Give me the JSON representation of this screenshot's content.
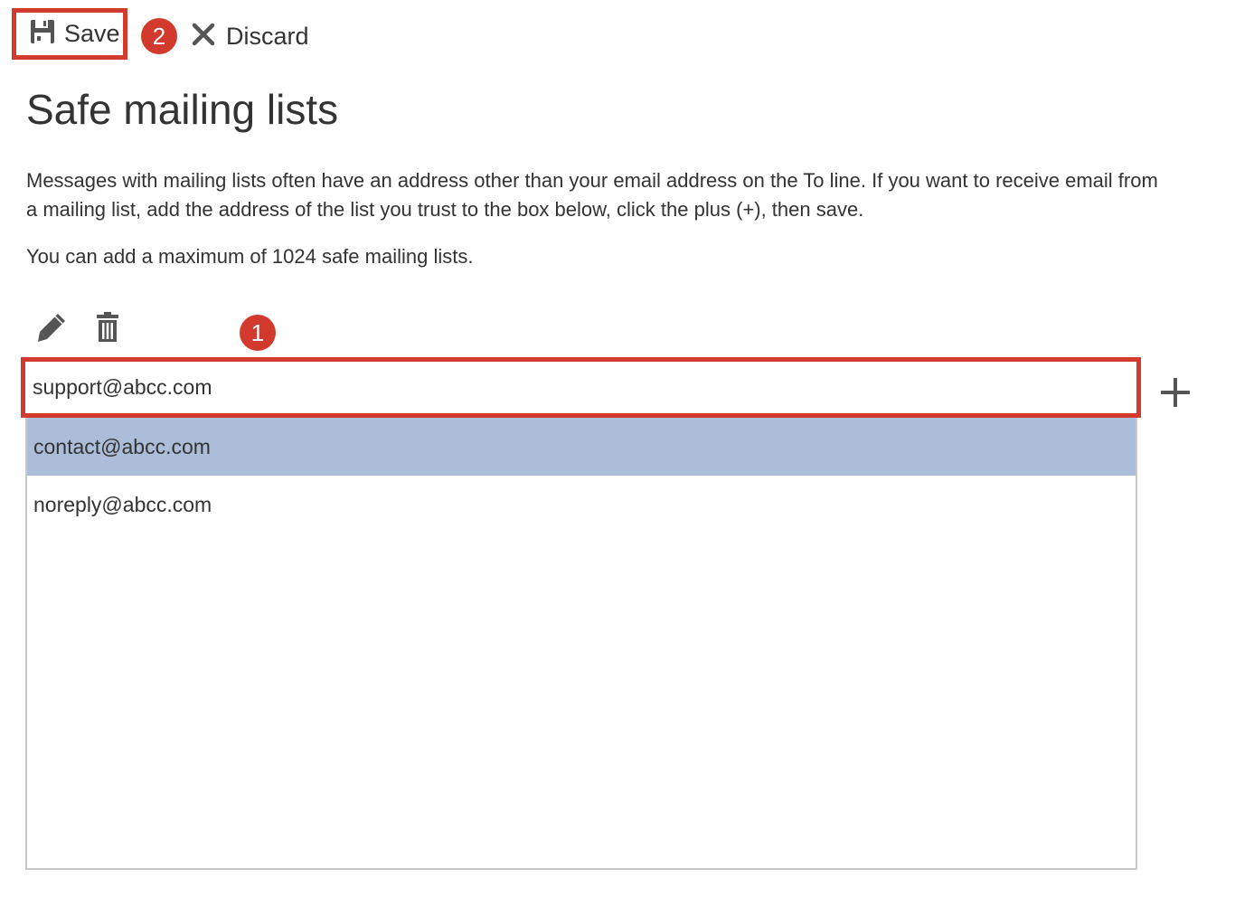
{
  "toolbar": {
    "save_label": "Save",
    "discard_label": "Discard",
    "save_step": "2"
  },
  "page": {
    "title": "Safe mailing lists",
    "description": "Messages with mailing lists often have an address other than your email address on the To line. If you want to receive email from a mailing list, add the address of the list you trust to the box below, click the plus (+), then save.",
    "limit_note": "You can add a maximum of 1024 safe mailing lists."
  },
  "input": {
    "value": "support@abcc.com",
    "step": "1"
  },
  "list": {
    "items": [
      {
        "address": "contact@abcc.com",
        "selected": true
      },
      {
        "address": "noreply@abcc.com",
        "selected": false
      }
    ]
  },
  "colors": {
    "highlight": "#d23a2e",
    "selected_row": "#abbdd9",
    "icon": "#555555"
  },
  "icons": [
    "save-icon",
    "close-icon",
    "pencil-icon",
    "trash-icon",
    "plus-icon"
  ]
}
